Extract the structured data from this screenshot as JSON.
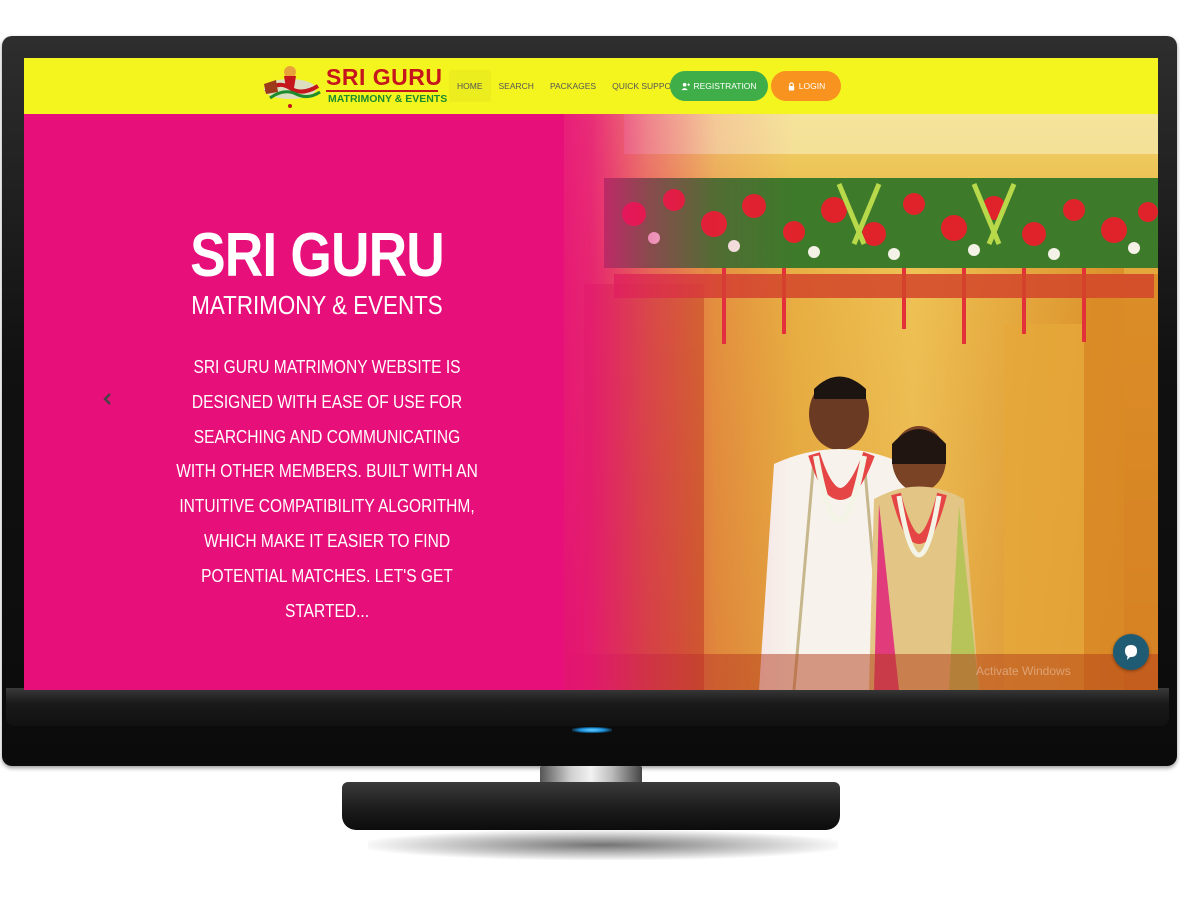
{
  "logo": {
    "title": "SRI GURU",
    "subtitle": "MATRIMONY & EVENTS"
  },
  "nav": {
    "items": [
      {
        "label": "HOME",
        "active": true
      },
      {
        "label": "SEARCH",
        "active": false
      },
      {
        "label": "PACKAGES",
        "active": false
      },
      {
        "label": "QUICK SUPPORT",
        "active": false,
        "dropdown": true
      }
    ],
    "registration_label": "REGISTRATION",
    "login_label": "LOGIN"
  },
  "hero": {
    "title": "SRI GURU",
    "subtitle": "MATRIMONY & EVENTS",
    "description": "SRI GURU MATRIMONY WEBSITE IS DESIGNED WITH EASE OF USE FOR SEARCHING AND COMMUNICATING WITH OTHER MEMBERS. BUILT WITH AN INTUITIVE COMPATIBILITY ALGORITHM, WHICH MAKE IT EASIER TO FIND POTENTIAL MATCHES.  LET'S GET STARTED...",
    "prev_icon": "chevron-left-icon"
  },
  "watermark": "Activate Windows",
  "colors": {
    "navbar_bg": "#f4f51f",
    "hero_bg": "#e70f7a",
    "registration_btn": "#3fae49",
    "login_btn": "#f7931e",
    "logo_red": "#c4161c",
    "logo_green": "#1e8b2c",
    "chat_bubble": "#1f5c73"
  },
  "icons": {
    "registration": "user-add-icon",
    "login": "lock-icon",
    "chat": "chat-bubble-icon"
  }
}
